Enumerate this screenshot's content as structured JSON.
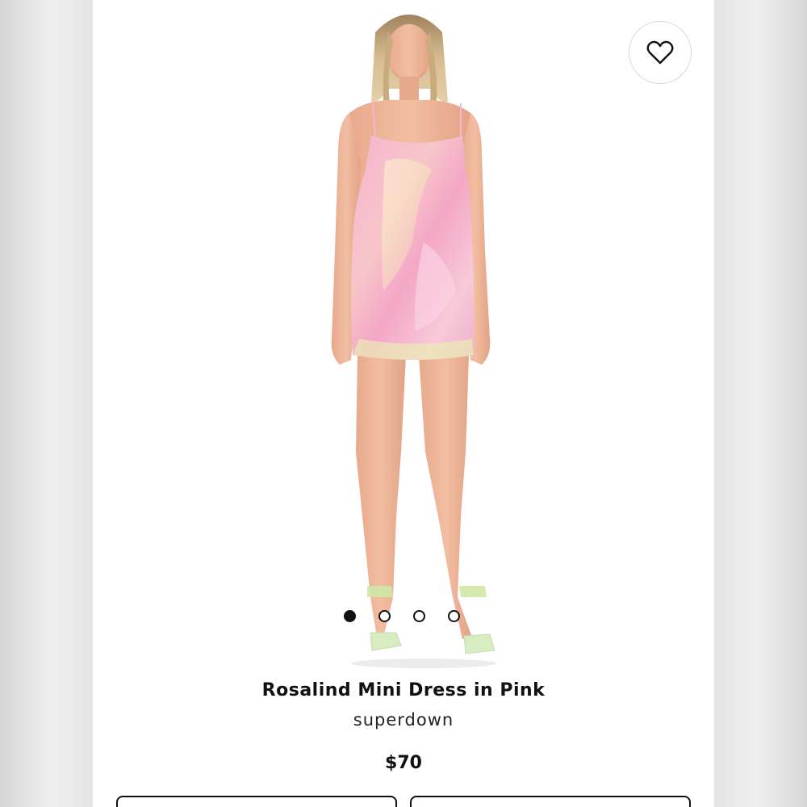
{
  "product": {
    "title": "Rosalind Mini Dress in Pink",
    "brand": "superdown",
    "price": "$70"
  },
  "gallery": {
    "image_count": 4,
    "active_index": 0
  },
  "icons": {
    "wishlist": "heart-outline-icon"
  },
  "colors": {
    "dress": "#f2a6c6",
    "text": "#111111",
    "background": "#ffffff"
  }
}
